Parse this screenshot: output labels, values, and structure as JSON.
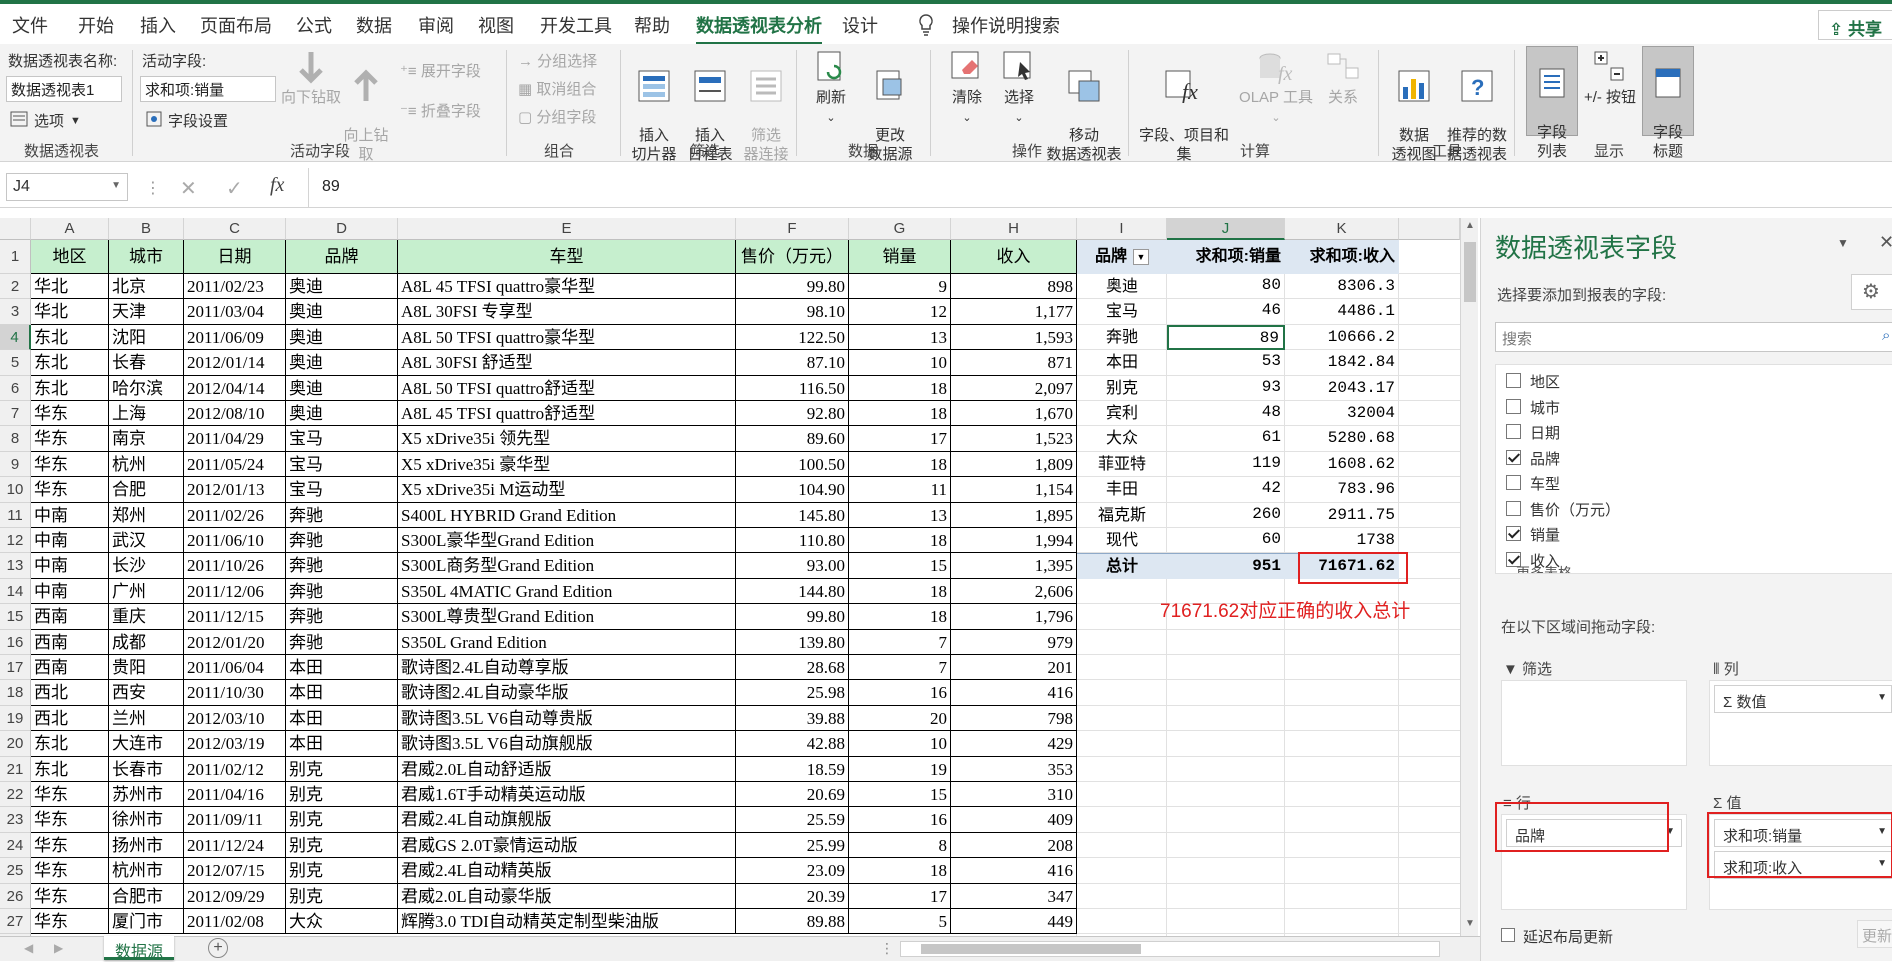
{
  "menu": {
    "tabs": [
      "文件",
      "开始",
      "插入",
      "页面布局",
      "公式",
      "数据",
      "审阅",
      "视图",
      "开发工具",
      "帮助",
      "数据透视表分析",
      "设计"
    ],
    "search_label": "操作说明搜索",
    "share_label": "共享"
  },
  "ribbon": {
    "pivot_name_label": "数据透视表名称:",
    "pivot_name_value": "数据透视表1",
    "options_label": "选项",
    "group_pivot": "数据透视表",
    "active_field_label": "活动字段:",
    "active_field_value": "求和项:销量",
    "field_settings_label": "字段设置",
    "drill_down": "向下钻取",
    "drill_up": "向上钻\n取",
    "expand_field": "展开字段",
    "collapse_field": "折叠字段",
    "group_active": "活动字段",
    "group_selection": "分组选择",
    "ungroup": "取消组合",
    "group_field": "分组字段",
    "group_group": "组合",
    "insert_slicer": "插入\n切片器",
    "insert_timeline": "插入\n日程表",
    "filter_connections": "筛选\n器连接",
    "group_filter": "筛选",
    "refresh": "刷新",
    "change_source": "更改\n数据源",
    "group_data": "数据",
    "clear": "清除",
    "select": "选择",
    "move_pivot": "移动\n数据透视表",
    "group_actions": "操作",
    "fields_items_sets": "字段、项目和\n集",
    "olap_tools": "OLAP 工具",
    "relationships": "关系",
    "group_calc": "计算",
    "pivot_chart": "数据\n透视图",
    "recommended_pivot": "推荐的数\n据透视表",
    "group_tools": "工具",
    "field_list": "字段\n列表",
    "plus_minus": "+/- 按钮",
    "field_headers": "字段\n标题",
    "group_show": "显示"
  },
  "formula_bar": {
    "name_box": "J4",
    "fx": "fx",
    "value": "89"
  },
  "columns": [
    "A",
    "B",
    "C",
    "D",
    "E",
    "F",
    "G",
    "H",
    "I",
    "J",
    "K"
  ],
  "table": {
    "headers": [
      "地区",
      "城市",
      "日期",
      "品牌",
      "车型",
      "售价（万元）",
      "销量",
      "收入"
    ],
    "rows": [
      [
        "华北",
        "北京",
        "2011/02/23",
        "奥迪",
        "A8L 45 TFSI quattro豪华型",
        "99.80",
        "9",
        "898"
      ],
      [
        "华北",
        "天津",
        "2011/03/04",
        "奥迪",
        "A8L 30FSI 专享型",
        "98.10",
        "12",
        "1,177"
      ],
      [
        "东北",
        "沈阳",
        "2011/06/09",
        "奥迪",
        "A8L 50 TFSI quattro豪华型",
        "122.50",
        "13",
        "1,593"
      ],
      [
        "东北",
        "长春",
        "2012/01/14",
        "奥迪",
        "A8L 30FSI 舒适型",
        "87.10",
        "10",
        "871"
      ],
      [
        "东北",
        "哈尔滨",
        "2012/04/14",
        "奥迪",
        "A8L 50 TFSI quattro舒适型",
        "116.50",
        "18",
        "2,097"
      ],
      [
        "华东",
        "上海",
        "2012/08/10",
        "奥迪",
        "A8L 45 TFSI quattro舒适型",
        "92.80",
        "18",
        "1,670"
      ],
      [
        "华东",
        "南京",
        "2011/04/29",
        "宝马",
        "X5 xDrive35i 领先型",
        "89.60",
        "17",
        "1,523"
      ],
      [
        "华东",
        "杭州",
        "2011/05/24",
        "宝马",
        "X5 xDrive35i 豪华型",
        "100.50",
        "18",
        "1,809"
      ],
      [
        "华东",
        "合肥",
        "2012/01/13",
        "宝马",
        "X5 xDrive35i M运动型",
        "104.90",
        "11",
        "1,154"
      ],
      [
        "中南",
        "郑州",
        "2011/02/26",
        "奔驰",
        "S400L HYBRID Grand Edition",
        "145.80",
        "13",
        "1,895"
      ],
      [
        "中南",
        "武汉",
        "2011/06/10",
        "奔驰",
        "S300L豪华型Grand Edition",
        "110.80",
        "18",
        "1,994"
      ],
      [
        "中南",
        "长沙",
        "2011/10/26",
        "奔驰",
        "S300L商务型Grand Edition",
        "93.00",
        "15",
        "1,395"
      ],
      [
        "中南",
        "广州",
        "2011/12/06",
        "奔驰",
        "S350L 4MATIC Grand Edition",
        "144.80",
        "18",
        "2,606"
      ],
      [
        "西南",
        "重庆",
        "2011/12/15",
        "奔驰",
        "S300L尊贵型Grand Edition",
        "99.80",
        "18",
        "1,796"
      ],
      [
        "西南",
        "成都",
        "2012/01/20",
        "奔驰",
        "S350L Grand Edition",
        "139.80",
        "7",
        "979"
      ],
      [
        "西南",
        "贵阳",
        "2011/06/04",
        "本田",
        "歌诗图2.4L自动尊享版",
        "28.68",
        "7",
        "201"
      ],
      [
        "西北",
        "西安",
        "2011/10/30",
        "本田",
        "歌诗图2.4L自动豪华版",
        "25.98",
        "16",
        "416"
      ],
      [
        "西北",
        "兰州",
        "2012/03/10",
        "本田",
        "歌诗图3.5L V6自动尊贵版",
        "39.88",
        "20",
        "798"
      ],
      [
        "东北",
        "大连市",
        "2012/03/19",
        "本田",
        "歌诗图3.5L V6自动旗舰版",
        "42.88",
        "10",
        "429"
      ],
      [
        "东北",
        "长春市",
        "2011/02/12",
        "别克",
        "君威2.0L自动舒适版",
        "18.59",
        "19",
        "353"
      ],
      [
        "华东",
        "苏州市",
        "2011/04/16",
        "别克",
        "君威1.6T手动精英运动版",
        "20.69",
        "15",
        "310"
      ],
      [
        "华东",
        "徐州市",
        "2011/09/11",
        "别克",
        "君威2.4L自动旗舰版",
        "25.59",
        "16",
        "409"
      ],
      [
        "华东",
        "扬州市",
        "2011/12/24",
        "别克",
        "君威GS 2.0T豪情运动版",
        "25.99",
        "8",
        "208"
      ],
      [
        "华东",
        "杭州市",
        "2012/07/15",
        "别克",
        "君威2.4L自动精英版",
        "23.09",
        "18",
        "416"
      ],
      [
        "华东",
        "合肥市",
        "2012/09/29",
        "别克",
        "君威2.0L自动豪华版",
        "20.39",
        "17",
        "347"
      ],
      [
        "华东",
        "厦门市",
        "2011/02/08",
        "大众",
        "辉腾3.0 TDI自动精英定制型柴油版",
        "89.88",
        "5",
        "449"
      ]
    ]
  },
  "pivot": {
    "headers": [
      "品牌",
      "求和项:销量",
      "求和项:收入"
    ],
    "rows": [
      [
        "奥迪",
        "80",
        "8306.3"
      ],
      [
        "宝马",
        "46",
        "4486.1"
      ],
      [
        "奔驰",
        "89",
        "10666.2"
      ],
      [
        "本田",
        "53",
        "1842.84"
      ],
      [
        "别克",
        "93",
        "2043.17"
      ],
      [
        "宾利",
        "48",
        "32004"
      ],
      [
        "大众",
        "61",
        "5280.68"
      ],
      [
        "菲亚特",
        "119",
        "1608.62"
      ],
      [
        "丰田",
        "42",
        "783.96"
      ],
      [
        "福克斯",
        "260",
        "2911.75"
      ],
      [
        "现代",
        "60",
        "1738"
      ]
    ],
    "total_label": "总计",
    "total_qty": "951",
    "total_rev": "71671.62",
    "annotation": "71671.62对应正确的收入总计"
  },
  "sheet_tab": "数据源",
  "field_pane": {
    "title": "数据透视表字段",
    "subtitle": "选择要添加到报表的字段:",
    "search_placeholder": "搜索",
    "fields": [
      {
        "name": "地区",
        "checked": false
      },
      {
        "name": "城市",
        "checked": false
      },
      {
        "name": "日期",
        "checked": false
      },
      {
        "name": "品牌",
        "checked": true
      },
      {
        "name": "车型",
        "checked": false
      },
      {
        "name": "售价（万元）",
        "checked": false
      },
      {
        "name": "销量",
        "checked": true
      },
      {
        "name": "收入",
        "checked": true
      }
    ],
    "more_tables": "更多表格...",
    "drag_label": "在以下区域间拖动字段:",
    "filter_label": "筛选",
    "columns_label": "列",
    "columns_item": "数值",
    "rows_label": "行",
    "rows_item": "品牌",
    "values_label": "值",
    "values_items": [
      "求和项:销量",
      "求和项:收入"
    ],
    "defer_label": "延迟布局更新",
    "update_label": "更新"
  }
}
